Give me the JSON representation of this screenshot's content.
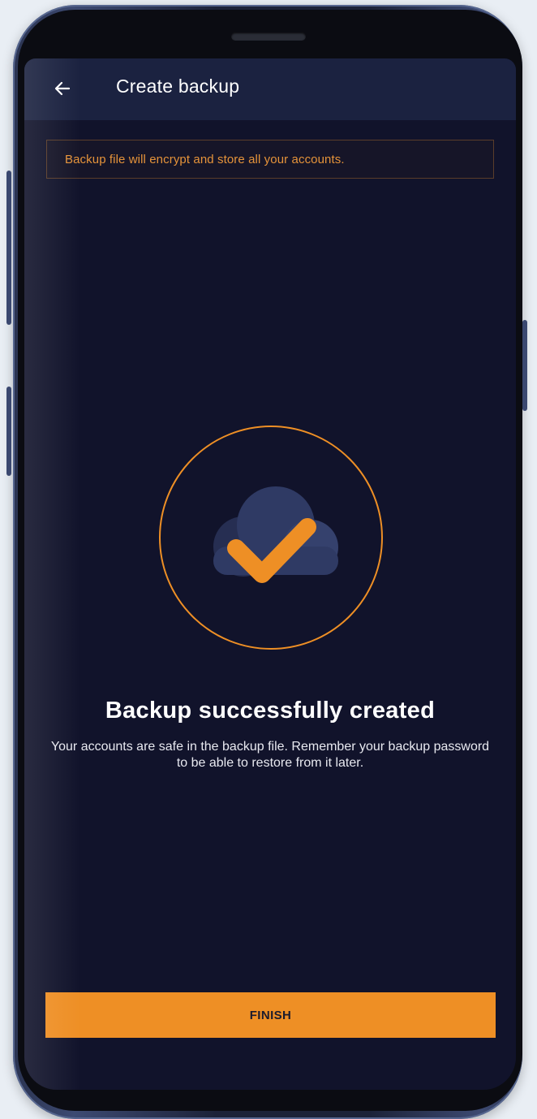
{
  "app_bar": {
    "title": "Create backup",
    "back_icon": "arrow-left-icon"
  },
  "info_banner": {
    "text": "Backup file will encrypt and store all your accounts."
  },
  "success": {
    "icon": "cloud-check-icon",
    "title": "Backup successfully created",
    "description": "Your accounts are safe in the backup file. Remember your backup password to be able to restore from it later."
  },
  "actions": {
    "finish_label": "FINISH"
  },
  "colors": {
    "background": "#11132b",
    "app_bar": "#1b2240",
    "accent": "#ee8f25",
    "banner_text": "#e5933a",
    "cloud": "#2f3a64"
  }
}
